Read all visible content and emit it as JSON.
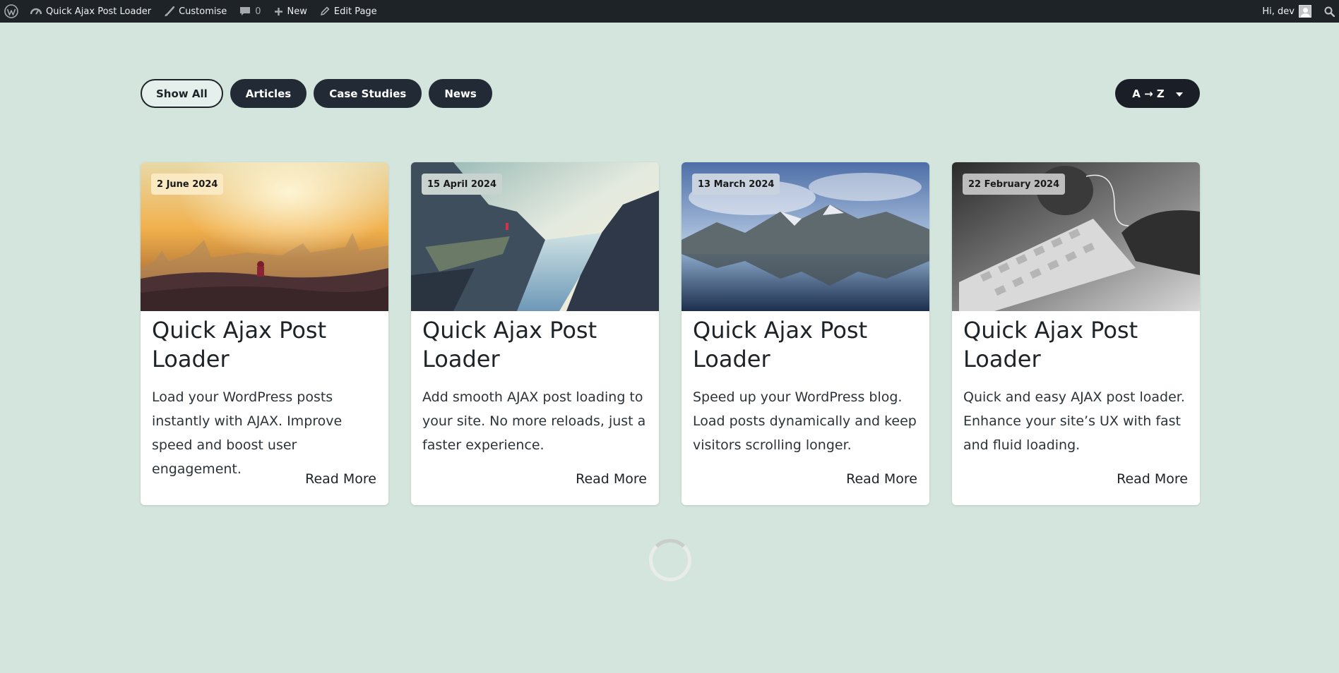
{
  "adminbar": {
    "site_name": "Quick Ajax Post Loader",
    "customise": "Customise",
    "comments_count": "0",
    "new": "New",
    "edit_page": "Edit Page",
    "greeting": "Hi, dev"
  },
  "filters": [
    "Show All",
    "Articles",
    "Case Studies",
    "News"
  ],
  "active_filter": "Show All",
  "sort": {
    "label": "A → Z"
  },
  "posts": [
    {
      "date": "2 June 2024",
      "title": "Quick Ajax Post Loader",
      "excerpt": "Load your WordPress posts instantly with AJAX. Improve speed and boost user engagement.",
      "read_more": "Read More"
    },
    {
      "date": "15 April 2024",
      "title": "Quick Ajax Post Loader",
      "excerpt": "Add smooth AJAX post loading to your site. No more reloads, just a faster experience.",
      "read_more": "Read More"
    },
    {
      "date": "13 March 2024",
      "title": "Quick Ajax Post Loader",
      "excerpt": "Speed up your WordPress blog. Load posts dynamically and keep visitors scrolling longer.",
      "read_more": "Read More"
    },
    {
      "date": "22 February 2024",
      "title": "Quick Ajax Post Loader",
      "excerpt": "Quick and easy AJAX post loader. Enhance your site’s UX with fast and fluid loading.",
      "read_more": "Read More"
    }
  ],
  "colors": {
    "background": "#d3e5dd",
    "adminbar": "#1d2327",
    "button_dark": "#222a35"
  }
}
